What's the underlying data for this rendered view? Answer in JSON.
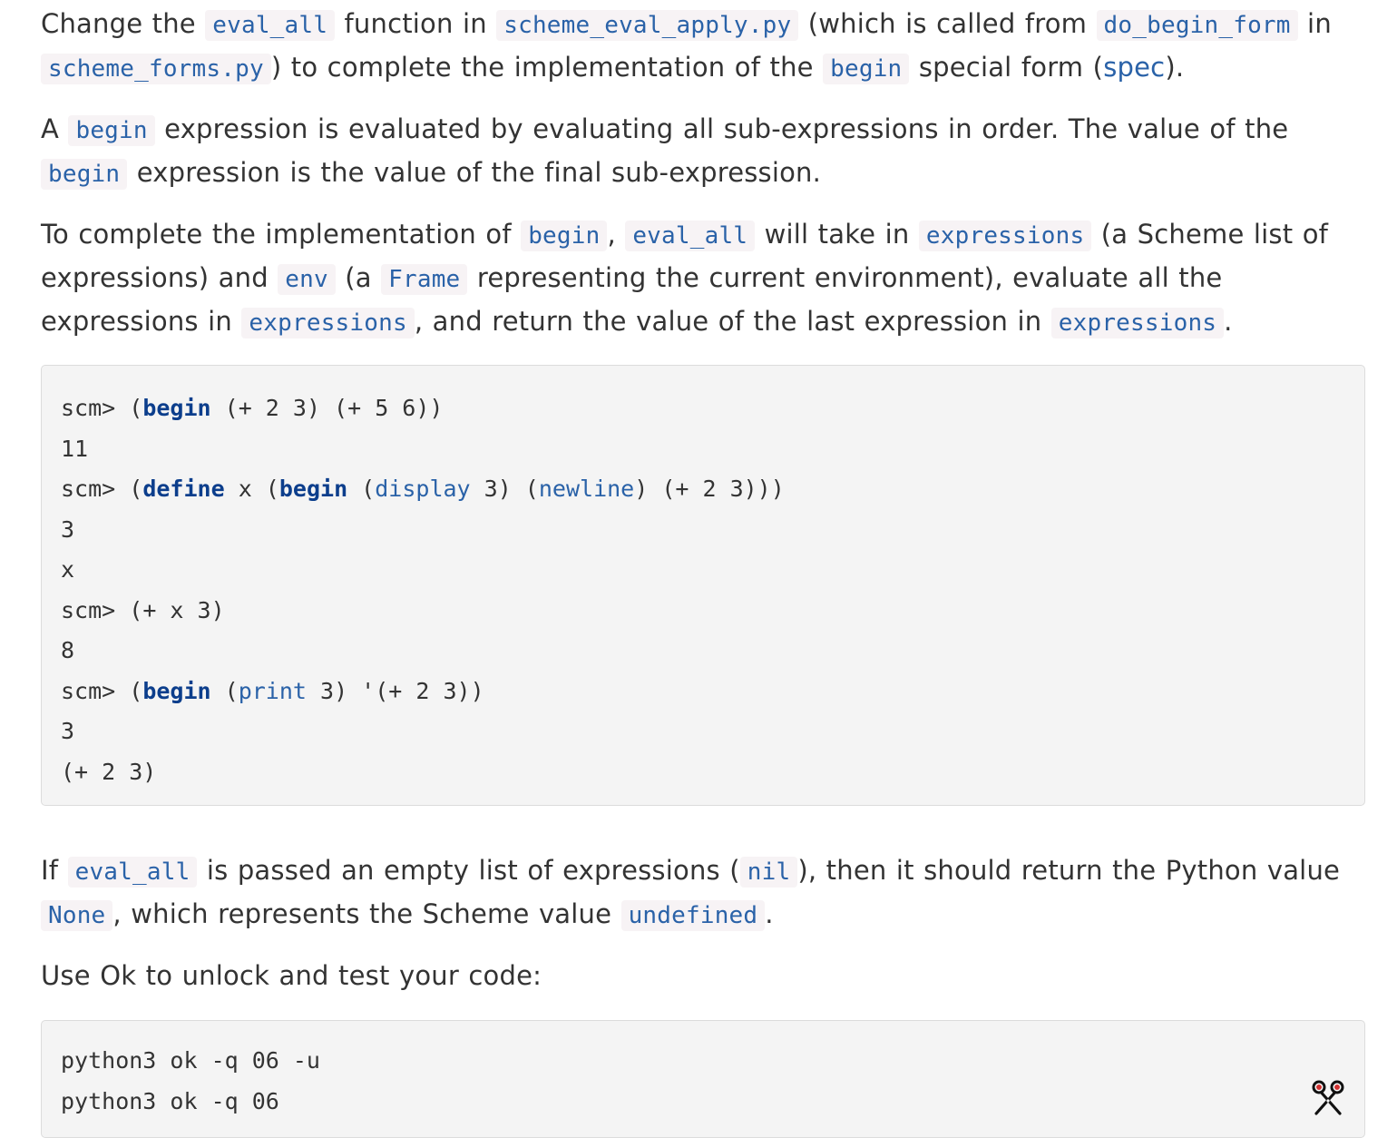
{
  "para1": {
    "t1": "Change the ",
    "c1": "eval_all",
    "t2": " function in ",
    "c2": "scheme_eval_apply.py",
    "t3": " (which is called from ",
    "c3": "do_begin_form",
    "t4": " in ",
    "c4": "scheme_forms.py",
    "t5": ") to complete the implementation of the ",
    "c5": "begin",
    "t6": " special form (",
    "link": "spec",
    "t7": ")."
  },
  "para2": {
    "t1": "A ",
    "c1": "begin",
    "t2": " expression is evaluated by evaluating all sub-expressions in order. The value of the ",
    "c2": "begin",
    "t3": " expression is the value of the final sub-expression."
  },
  "para3": {
    "t1": "To complete the implementation of ",
    "c1": "begin",
    "t2": ", ",
    "c2": "eval_all",
    "t3": " will take in ",
    "c3": "expressions",
    "t4": " (a Scheme list of expressions) and ",
    "c4": "env",
    "t5": " (a ",
    "c5": "Frame",
    "t6": " representing the current environment), evaluate all the expressions in ",
    "c6": "expressions",
    "t7": ", and return the value of the last expression in ",
    "c7": "expressions",
    "t8": "."
  },
  "scheme_example": {
    "l1": {
      "prompt": "scm> ",
      "a": "(",
      "kw": "begin",
      "b": " (+ 2 3) (+ 5 6))"
    },
    "l2": "11",
    "l3": {
      "prompt": "scm> ",
      "a": "(",
      "kw1": "define",
      "b": " x (",
      "kw2": "begin",
      "c": " (",
      "fn1": "display",
      "d": " 3) (",
      "fn2": "newline",
      "e": ") (+ 2 3)))"
    },
    "l4": "3",
    "l5": "x",
    "l6": {
      "prompt": "scm> ",
      "a": "(+ x 3)"
    },
    "l7": "8",
    "l8": {
      "prompt": "scm> ",
      "a": "(",
      "kw": "begin",
      "b": " (",
      "fn": "print",
      "c": " 3) '(+ 2 3))"
    },
    "l9": "3",
    "l10": "(+ 2 3)"
  },
  "para4": {
    "t1": "If ",
    "c1": "eval_all",
    "t2": " is passed an empty list of expressions (",
    "c2": "nil",
    "t3": "), then it should return the Python value ",
    "c3": "None",
    "t4": ", which represents the Scheme value ",
    "c4": "undefined",
    "t5": "."
  },
  "para5": {
    "t1": "Use Ok to unlock and test your code:"
  },
  "ok_commands": {
    "l1": "python3 ok -q 06 -u",
    "l2": "python3 ok -q 06"
  },
  "icons": {
    "copy": "scissors-icon"
  },
  "colors": {
    "inline_code": "#2a62a8",
    "keyword": "#0c3e8c",
    "code_bg": "#f4f4f4",
    "inline_bg": "#f7f3f5"
  }
}
